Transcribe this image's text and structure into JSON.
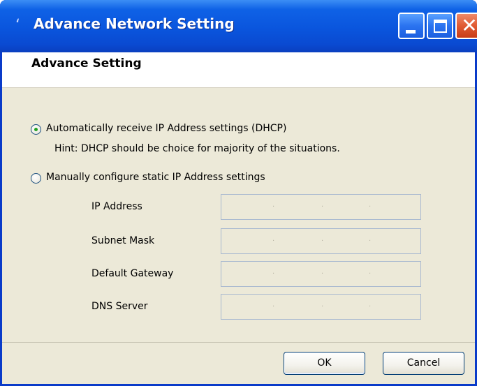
{
  "window": {
    "title": "Advance Network Setting",
    "controls": {
      "minimize": "minimize",
      "maximize": "maximize",
      "close": "close"
    }
  },
  "header": {
    "title": "Advance Setting"
  },
  "options": {
    "dhcp": {
      "label": "Automatically receive IP Address settings (DHCP)",
      "selected": true
    },
    "hint": "Hint: DHCP should be choice for majority of the situations.",
    "static": {
      "label": "Manually configure static IP Address settings",
      "selected": false
    }
  },
  "fields": [
    {
      "label": "IP Address",
      "value": "",
      "enabled": false
    },
    {
      "label": "Subnet Mask",
      "value": "",
      "enabled": false
    },
    {
      "label": "Default Gateway",
      "value": "",
      "enabled": false
    },
    {
      "label": "DNS Server",
      "value": "",
      "enabled": false
    }
  ],
  "buttons": {
    "ok": "OK",
    "cancel": "Cancel"
  },
  "colors": {
    "titlebar": "#0a55dd",
    "client_bg": "#ece9d8",
    "radio_dot": "#21a121",
    "close_button": "#e05a32"
  }
}
